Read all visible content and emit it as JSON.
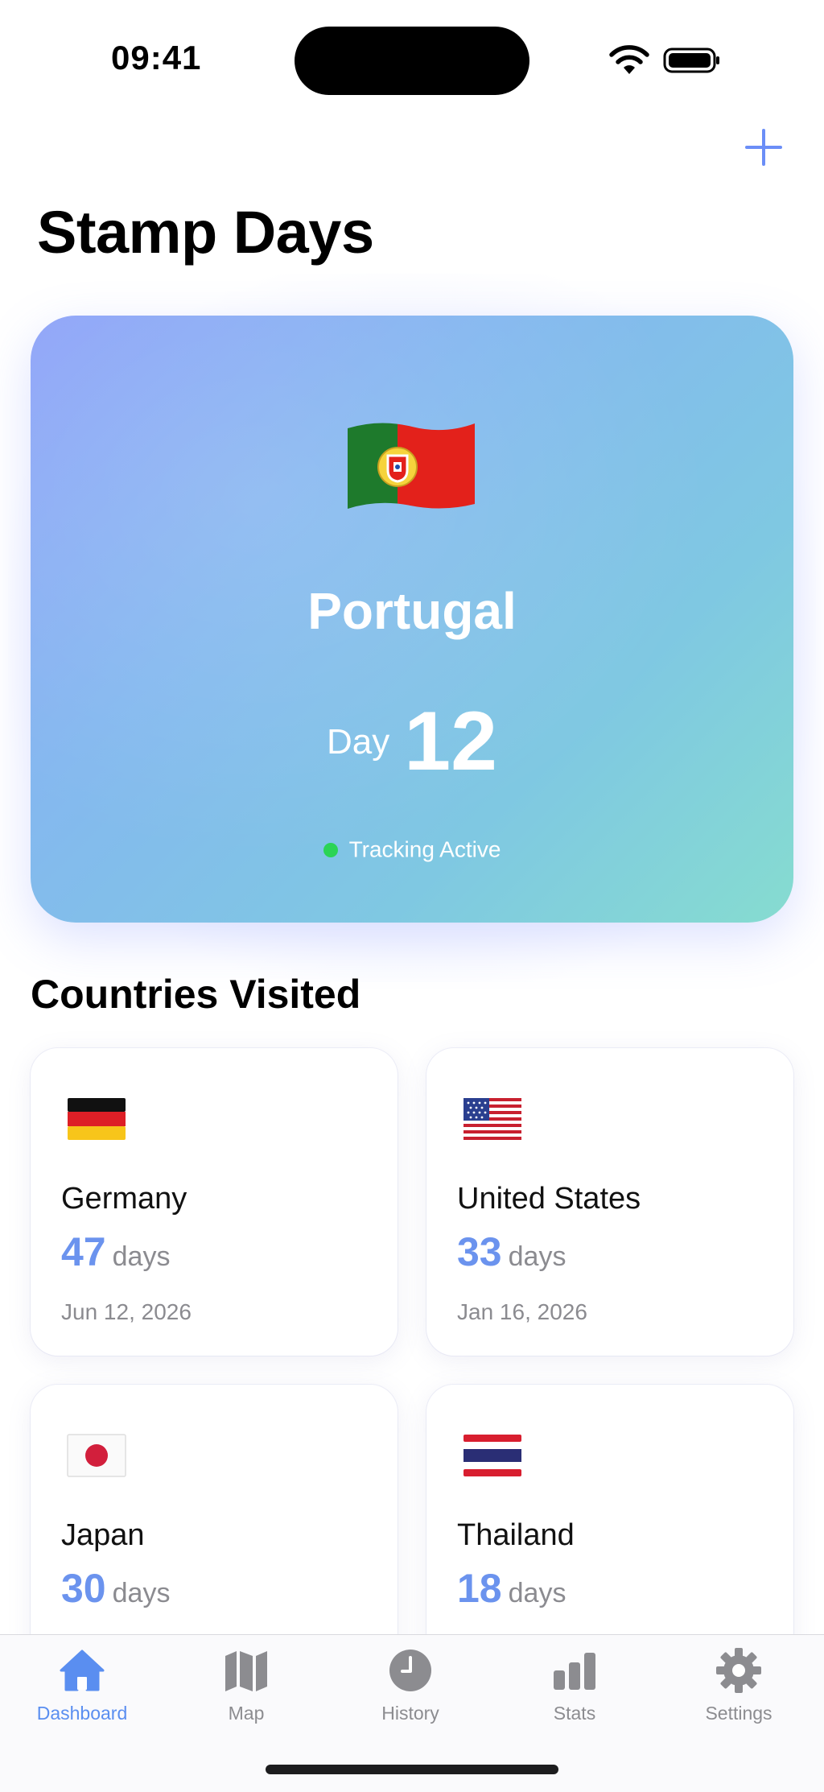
{
  "status_bar": {
    "time": "09:41"
  },
  "header": {
    "title": "Stamp Days"
  },
  "hero": {
    "country": "Portugal",
    "day_label": "Day",
    "day_value": "12",
    "status": "Tracking Active",
    "flag_icon": "portugal-flag-icon"
  },
  "section": {
    "title": "Countries Visited"
  },
  "countries": [
    {
      "name": "Germany",
      "days": "47",
      "unit": "days",
      "date": "Jun 12, 2026",
      "flag_icon": "germany-flag-icon"
    },
    {
      "name": "United States",
      "days": "33",
      "unit": "days",
      "date": "Jan 16, 2026",
      "flag_icon": "usa-flag-icon"
    },
    {
      "name": "Japan",
      "days": "30",
      "unit": "days",
      "date": "",
      "flag_icon": "japan-flag-icon"
    },
    {
      "name": "Thailand",
      "days": "18",
      "unit": "days",
      "date": "",
      "flag_icon": "thailand-flag-icon"
    }
  ],
  "tabs": [
    {
      "label": "Dashboard",
      "icon": "house-icon",
      "active": true
    },
    {
      "label": "Map",
      "icon": "map-icon",
      "active": false
    },
    {
      "label": "History",
      "icon": "clock-icon",
      "active": false
    },
    {
      "label": "Stats",
      "icon": "chart-bar-icon",
      "active": false
    },
    {
      "label": "Settings",
      "icon": "gear-icon",
      "active": false
    }
  ],
  "colors": {
    "accent": "#5a8ef0",
    "days_number": "#6b93ee",
    "tracking_dot": "#2bd455",
    "tab_inactive": "#8c8c90"
  }
}
